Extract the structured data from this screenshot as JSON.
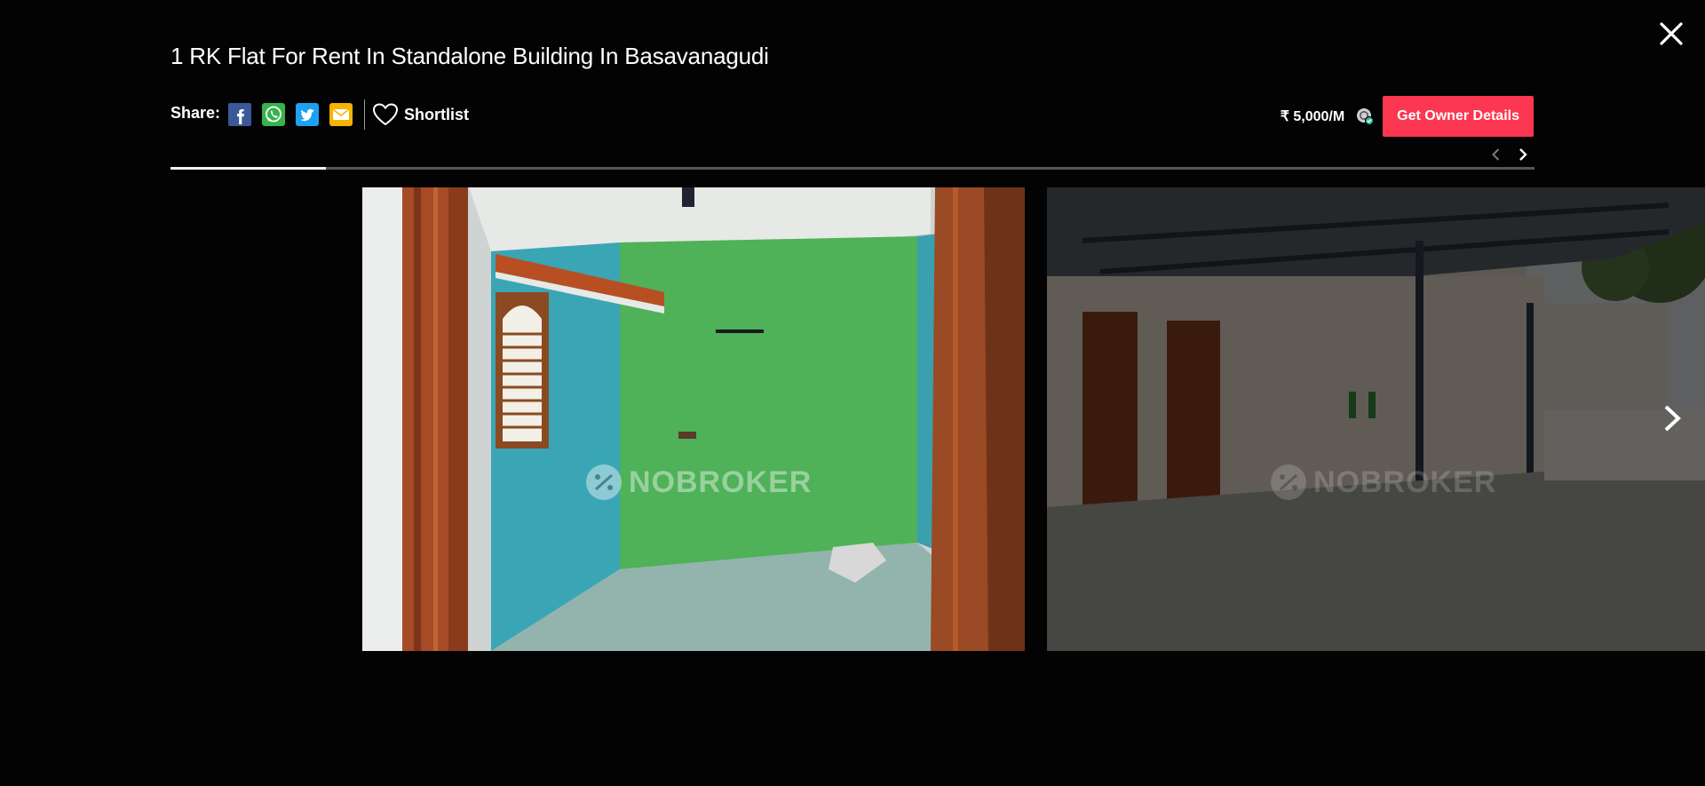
{
  "listing": {
    "title": "1 RK Flat For Rent In Standalone Building In Basavanagudi",
    "price": "₹ 5,000/M"
  },
  "share": {
    "label": "Share:",
    "icons": [
      "facebook-icon",
      "whatsapp-icon",
      "twitter-icon",
      "email-icon"
    ]
  },
  "shortlist": {
    "label": "Shortlist",
    "icon": "heart-icon"
  },
  "cta": {
    "owner_label": "Get Owner Details",
    "color": "#fd3752"
  },
  "gallery": {
    "progress": 0.114,
    "watermark": "NOBROKER",
    "slides": [
      {
        "description": "Room with green and blue walls",
        "active": true
      },
      {
        "description": "Terrace with metal roof",
        "active": false
      }
    ]
  },
  "controls": {
    "close_icon": "close-icon",
    "next_icon": "chevron-right-icon",
    "prev_icon": "chevron-left-icon"
  }
}
